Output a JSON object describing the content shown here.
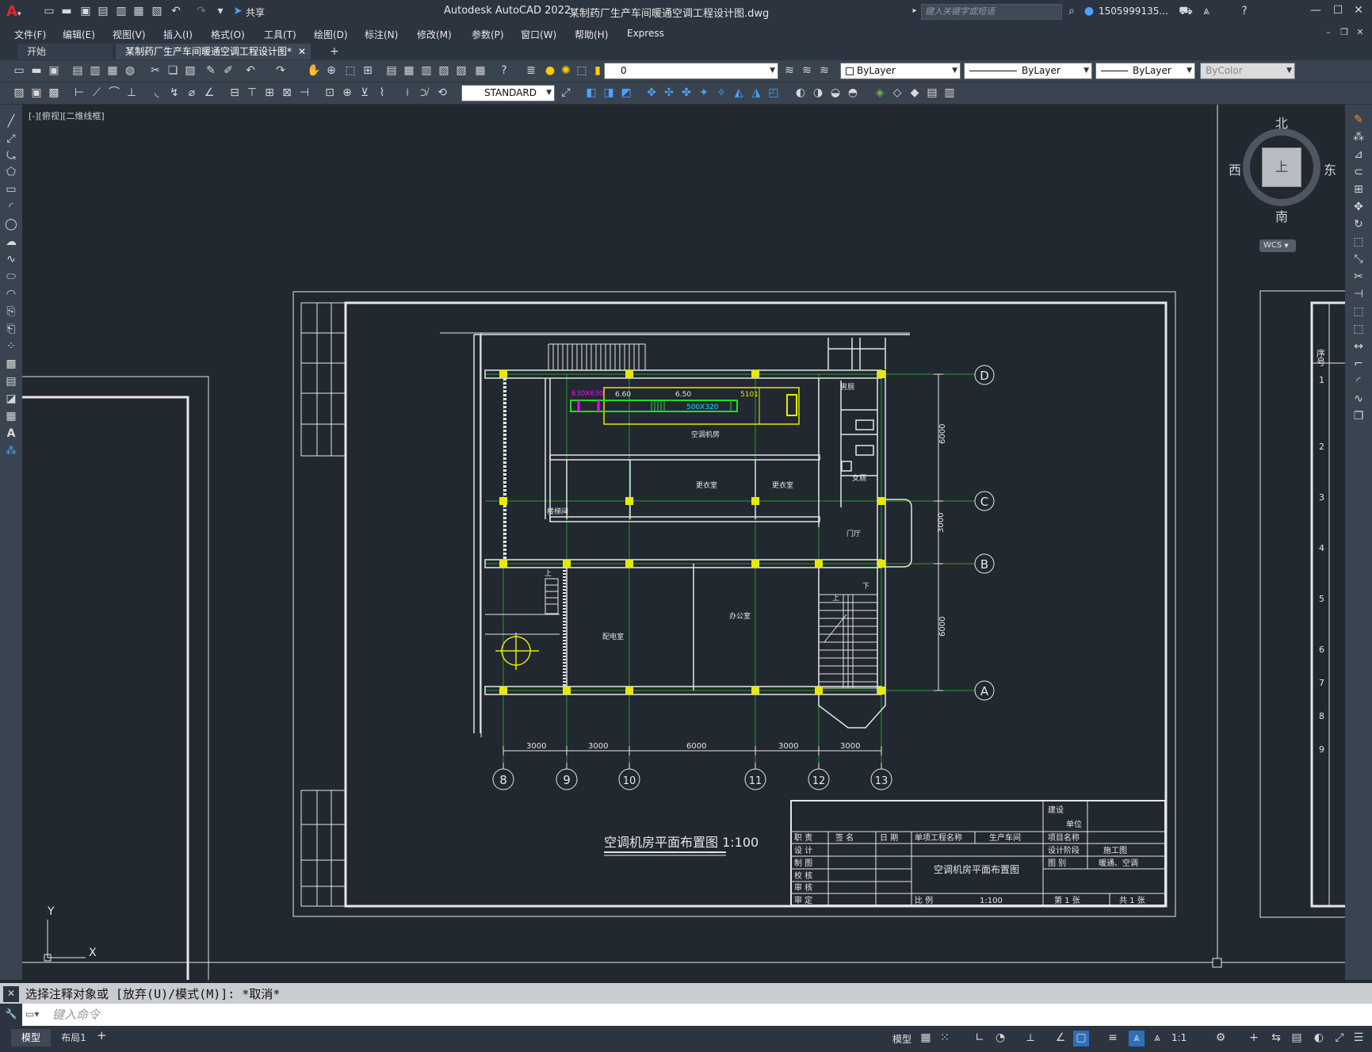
{
  "titlebar": {
    "app_title": "Autodesk AutoCAD 2022",
    "doc_title": "某制药厂生产车间暖通空调工程设计图.dwg",
    "share_label": "共享",
    "search_placeholder": "键入关键字或短语",
    "user": "1505999135..."
  },
  "menu": [
    "文件(F)",
    "编辑(E)",
    "视图(V)",
    "插入(I)",
    "格式(O)",
    "工具(T)",
    "绘图(D)",
    "标注(N)",
    "修改(M)",
    "参数(P)",
    "窗口(W)",
    "帮助(H)",
    "Express"
  ],
  "tabs": {
    "start": "开始",
    "doc": "某制药厂生产车间暖通空调工程设计图*",
    "add": "+"
  },
  "toolbar": {
    "layer": "0",
    "color": "ByLayer",
    "linetype": "ByLayer",
    "lineweight": "ByLayer",
    "plotstyle": "ByColor",
    "textstyle": "STANDARD"
  },
  "viewport_label": "[-][俯视][二维线框]",
  "viewcube": {
    "north": "北",
    "south": "南",
    "east": "东",
    "west": "西",
    "top": "上",
    "wcs": "WCS"
  },
  "drawing": {
    "title": "空调机房平面布置图 1:100",
    "axes_right": [
      "D",
      "C",
      "B",
      "A"
    ],
    "axes_bottom": [
      "8",
      "9",
      "10",
      "11",
      "12",
      "13"
    ],
    "dims_bottom": [
      "3000",
      "3000",
      "6000",
      "3000",
      "3000"
    ],
    "dims_right": [
      "6000",
      "3000",
      "6000"
    ],
    "duct_labels": [
      "630X630",
      "6.60",
      "6.50",
      "500X320",
      "5101"
    ],
    "rooms": [
      "空调机房",
      "更衣室",
      "更衣室",
      "门厅",
      "配电室",
      "办公室",
      "女厕",
      "男厕",
      "楼梯间"
    ],
    "stair_labels": [
      "上",
      "下"
    ],
    "titleblock": {
      "headers": [
        "职 责",
        "签 名",
        "日 期",
        "单项工程名称",
        "生产车间",
        "项目名称"
      ],
      "roles": [
        "设 计",
        "制 图",
        "校 核",
        "审 核",
        "审 定"
      ],
      "drawing_name": "空调机房平面布置图",
      "scale_label": "比 例",
      "scale": "1:100",
      "build_unit": "建设",
      "unit": "单位",
      "stage_label": "设计阶段",
      "stage": "施工图",
      "type_label": "图 别",
      "type": "暖通、空调",
      "sheet_no": "第 1 张",
      "sheet_total": "共 1 张"
    },
    "side_table": {
      "header": "序号",
      "rows": [
        "1",
        "2",
        "3",
        "4",
        "5",
        "6",
        "7",
        "8",
        "9"
      ]
    }
  },
  "ucs": {
    "x": "X",
    "y": "Y"
  },
  "command": {
    "history": "选择注释对象或 [放弃(U)/模式(M)]: *取消*",
    "placeholder": "键入命令"
  },
  "status": {
    "model_tab": "模型",
    "layout_tab": "布局1",
    "add": "+",
    "model_space": "模型",
    "scale": "1:1"
  }
}
